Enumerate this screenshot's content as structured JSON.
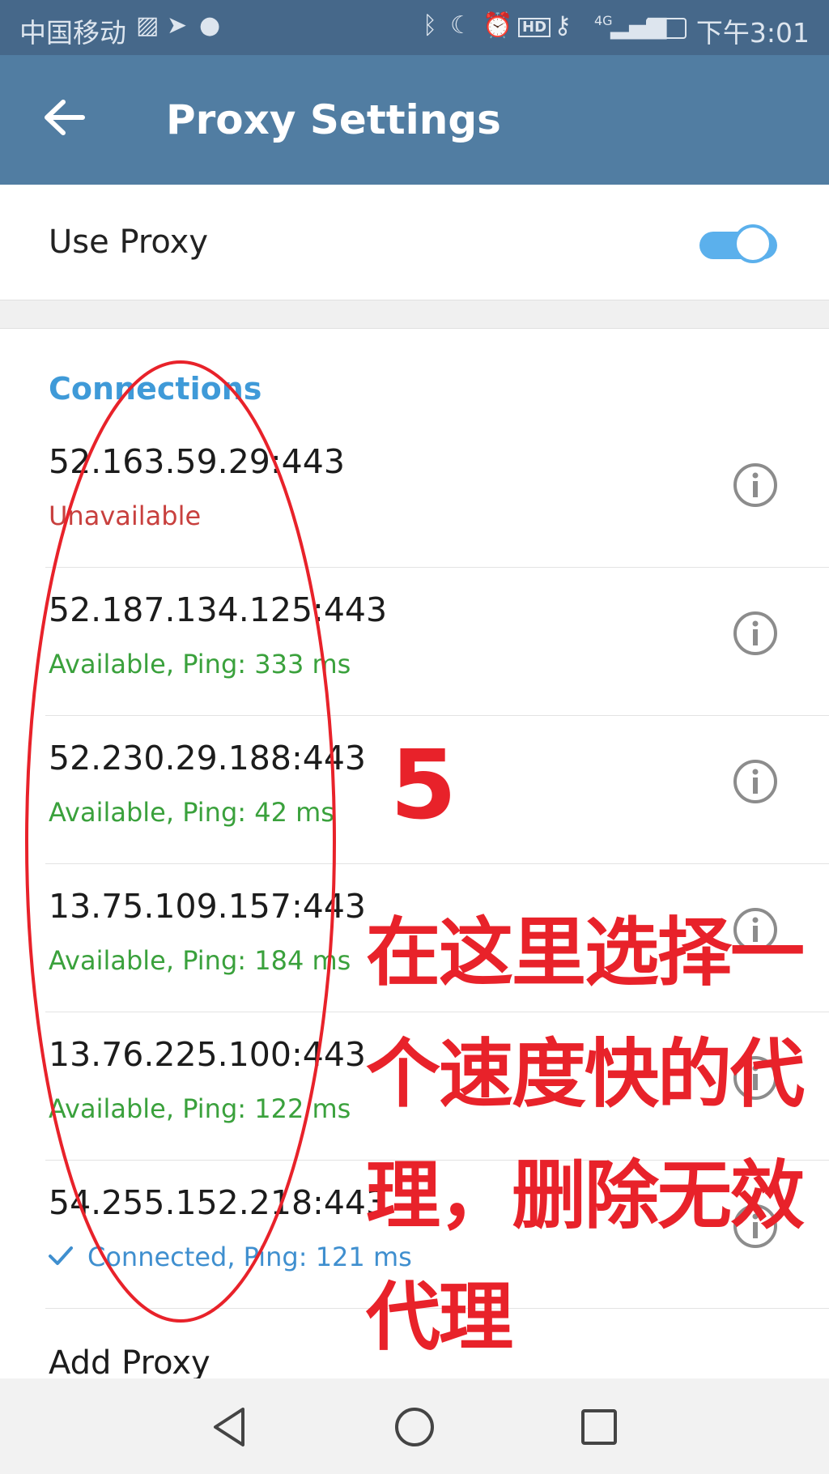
{
  "status_bar": {
    "carrier": "中国移动",
    "network": "4G",
    "time": "下午3:01"
  },
  "app_bar": {
    "title": "Proxy Settings",
    "back_icon": "arrow-left-icon"
  },
  "use_proxy": {
    "label": "Use Proxy",
    "enabled": true
  },
  "connections": {
    "header": "Connections",
    "items": [
      {
        "address": "52.163.59.29:443",
        "status": "Unavailable",
        "state": "unavailable"
      },
      {
        "address": "52.187.134.125:443",
        "status": "Available, Ping: 333 ms",
        "state": "available"
      },
      {
        "address": "52.230.29.188:443",
        "status": "Available, Ping: 42 ms",
        "state": "available"
      },
      {
        "address": "13.75.109.157:443",
        "status": "Available, Ping: 184 ms",
        "state": "available"
      },
      {
        "address": "13.76.225.100:443",
        "status": "Available, Ping: 122 ms",
        "state": "available"
      },
      {
        "address": "54.255.152.218:443",
        "status": "Connected, Ping: 121 ms",
        "state": "connected"
      }
    ],
    "add_label": "Add Proxy"
  },
  "annotation": {
    "number": "5",
    "lines": [
      "在这里选择一",
      "个速度快的代",
      "理，删除无效",
      "代理"
    ]
  },
  "colors": {
    "app_bar": "#517da2",
    "status_bar": "#46688a",
    "accent": "#3f9ad8",
    "unavailable": "#c8403e",
    "available": "#3aa13c",
    "annotation": "#e8222a"
  }
}
